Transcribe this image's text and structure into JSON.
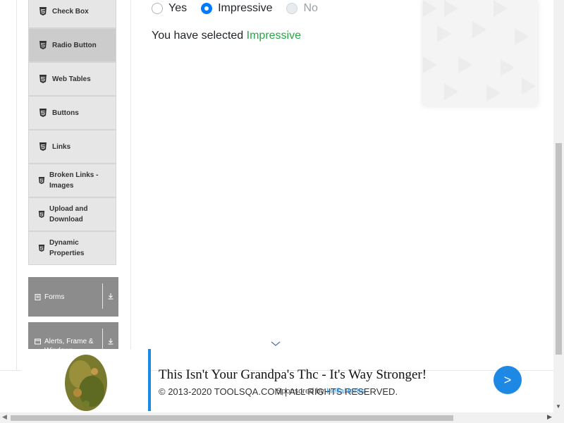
{
  "sidebar": {
    "items": [
      {
        "label": "Check Box",
        "active": false
      },
      {
        "label": "Radio Button",
        "active": true
      },
      {
        "label": "Web Tables",
        "active": false
      },
      {
        "label": "Buttons",
        "active": false
      },
      {
        "label": "Links",
        "active": false
      },
      {
        "label": "Broken Links - Images",
        "active": false
      },
      {
        "label": "Upload and Download",
        "active": false
      },
      {
        "label": "Dynamic Properties",
        "active": false
      }
    ],
    "groups": [
      {
        "label": "Forms"
      },
      {
        "label": "Alerts, Frame & Windows"
      }
    ]
  },
  "radio": {
    "options": [
      {
        "label": "Yes",
        "state": "unchecked"
      },
      {
        "label": "Impressive",
        "state": "checked"
      },
      {
        "label": "No",
        "state": "disabled"
      }
    ],
    "result_prefix": "You have selected ",
    "result_value": "Impressive"
  },
  "footer": {
    "text": "© 2013-2020 TOOLSQA.COM | ALL RIGHTS RESERVED."
  },
  "banner": {
    "title": "This Isn't Your Grandpa's Thc - It's Way Stronger!",
    "sponsor_prefix": "Sponsored by ",
    "sponsor_brand": "HeliaHerbs",
    "button_label": ">"
  },
  "colors": {
    "accent": "#007bff",
    "result": "#28a745",
    "menu_bg": "#e6e6e6",
    "menu_active": "#cccccc",
    "group_bg": "#8c8c8c",
    "banner_blue": "#1e88e5"
  }
}
